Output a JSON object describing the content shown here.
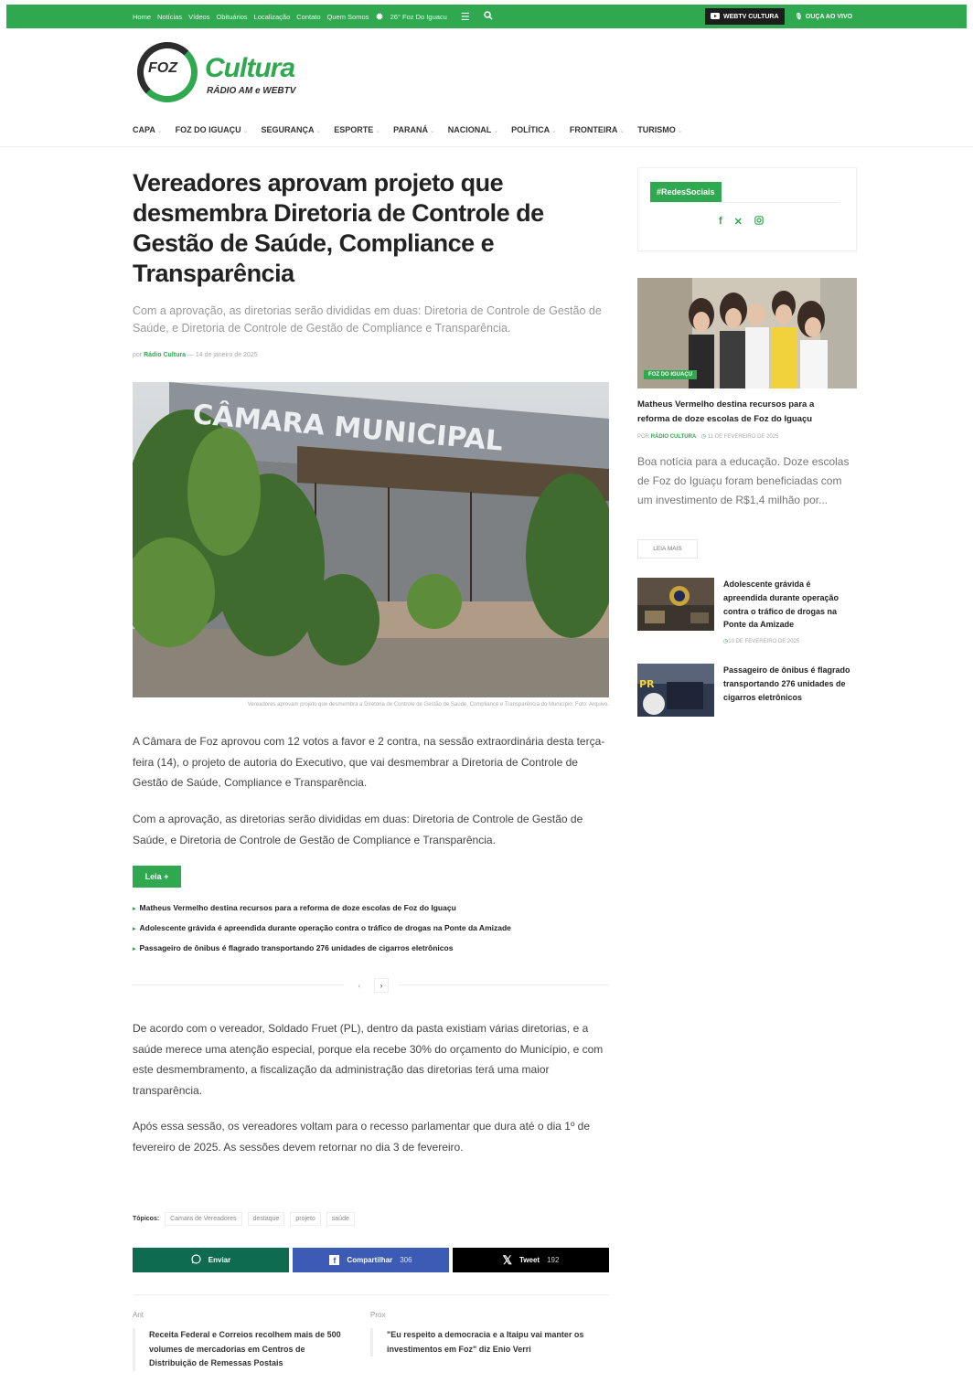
{
  "topbar": {
    "links": [
      "Home",
      "Notícias",
      "Vídeos",
      "Obituários",
      "Localização",
      "Contato",
      "Quem Somos"
    ],
    "weather": "26°  Foz Do Iguacu",
    "webtv_label": "WEBTV CULTURA",
    "listen_label": "OUÇA AO VIVO"
  },
  "logo": {
    "foz": "FOZ",
    "name": "Cultura",
    "tagline": "RÁDIO AM e WEBTV"
  },
  "mainnav": [
    "CAPA",
    "FOZ DO IGUAÇU",
    "SEGURANÇA",
    "ESPORTE",
    "PARANÁ",
    "NACIONAL",
    "POLÍTICA",
    "FRONTEIRA",
    "TURISMO"
  ],
  "article": {
    "title": "Vereadores aprovam projeto que desmembra Diretoria de Controle de Gestão de Saúde, Compliance e Transparência",
    "subtitle": "Com a aprovação, as diretorias serão divididas em duas: Diretoria de Controle de Gestão de Saúde, e Diretoria de Controle de Gestão de Compliance e Transparência.",
    "by_prefix": "por",
    "author": "Rádio Cultura",
    "date": "14 de janeiro de 2025",
    "photo_sign": "CÂMARA MUNICIPAL",
    "caption": "Vereadores aprovam projeto que desmembra a Diretoria de Controle de Gestão de Saúde, Compliance e Transparência do Município. Foto: Arquivo.",
    "p1": "A Câmara de Foz aprovou com 12 votos a favor e 2 contra, na sessão extraordinária desta terça-feira (14), o projeto de autoria do Executivo, que vai desmembrar a Diretoria de Controle de Gestão de Saúde, Compliance e Transparência.",
    "p2": "Com a aprovação, as diretorias serão divididas em duas: Diretoria de Controle de Gestão de Saúde, e Diretoria de Controle de Gestão de Compliance e Transparência.",
    "leia_label": "Leia +",
    "related": [
      "Matheus Vermelho destina recursos para a reforma de doze escolas de Foz do Iguaçu",
      "Adolescente grávida é apreendida durante operação contra o tráfico de drogas na Ponte da Amizade",
      "Passageiro de ônibus é flagrado transportando 276 unidades de cigarros eletrônicos"
    ],
    "pager_prev": "‹",
    "pager_next": "›",
    "p3": "De acordo com o vereador, Soldado Fruet (PL), dentro da pasta existiam várias diretorias, e a saúde merece uma atenção especial, porque ela recebe 30% do orçamento do Município, e com este desmembramento, a fiscalização da administração das diretorias terá uma maior transparência.",
    "p4": "Após essa sessão, os vereadores voltam para o recesso parlamentar que dura até o dia 1º de fevereiro de 2025. As sessões devem retornar no dia 3 de fevereiro.",
    "topics_label": "Tópicos:",
    "topics": [
      "Camara de Vereadores",
      "destaque",
      "projeto",
      "saúde"
    ]
  },
  "share": {
    "whatsapp": "Enviar",
    "facebook": "Compartilhar",
    "facebook_count": "306",
    "x": "Tweet",
    "x_count": "192"
  },
  "prevnext": {
    "prev_label": "Ant",
    "prev_title": "Receita Federal e Correios recolhem mais de 500 volumes de mercadorias em Centros de Distribuição de Remessas Postais",
    "next_label": "Prox",
    "next_title": "\"Eu respeito a democracia e a Itaipu vai manter os investimentos em Foz\" diz Enio Verri"
  },
  "sidebar": {
    "social_header": "#RedesSociais",
    "featured": {
      "category": "FOZ DO IGUAÇU",
      "title": "Matheus Vermelho destina recursos para a reforma de doze escolas de Foz do Iguaçu",
      "by": "POR",
      "author": "RÁDIO CULTURA",
      "date": "11 DE FEVEREIRO DE 2025",
      "excerpt": "Boa notícia para a educação. Doze escolas de Foz do Iguaçu foram beneficiadas com um investimento de R$1,4 milhão por...",
      "more": "LEIA MAIS"
    },
    "small": [
      {
        "title": "Adolescente grávida é apreendida durante operação contra o tráfico de drogas na Ponte da Amizade",
        "date": "10 DE FEVEREIRO DE 2025"
      },
      {
        "title": "Passageiro de ônibus é flagrado transportando 276 unidades de cigarros eletrônicos",
        "date": ""
      }
    ]
  },
  "colors": {
    "brand": "#2fa84f",
    "whatsapp": "#0f6b4f",
    "facebook": "#3b5bb5",
    "x": "#000000"
  }
}
